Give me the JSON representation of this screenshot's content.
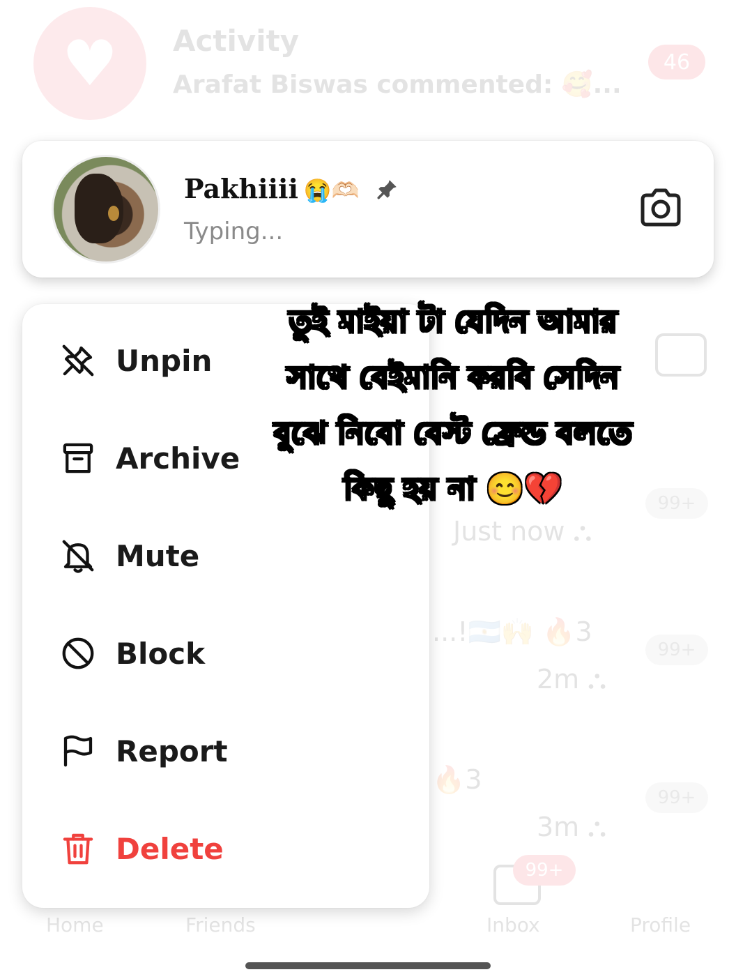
{
  "background": {
    "activity_title": "Activity",
    "activity_subtitle": "Arafat Biswas commented: 🥰...",
    "activity_badge": "46",
    "rows": [
      {
        "text": "Just now ⛬",
        "badge": "99+"
      },
      {
        "text": "...!🇦🇷🙌 🔥3",
        "badge": "99+"
      },
      {
        "text": "2m ⛬",
        "badge": ""
      },
      {
        "text": "🔥3",
        "badge": "99+"
      },
      {
        "text": "3m ⛬",
        "badge": ""
      }
    ],
    "nav": {
      "home": "Home",
      "friends": "Friends",
      "inbox": "Inbox",
      "inbox_badge": "99+",
      "profile": "Profile"
    }
  },
  "chat": {
    "name": "Pakhiiii",
    "name_emojis": "😭🫶🏻",
    "status": "Typing...",
    "pinned": true
  },
  "menu": {
    "items": [
      {
        "label": "Unpin",
        "icon": "unpin-icon"
      },
      {
        "label": "Archive",
        "icon": "archive-icon"
      },
      {
        "label": "Mute",
        "icon": "mute-bell-icon"
      },
      {
        "label": "Block",
        "icon": "block-icon"
      },
      {
        "label": "Report",
        "icon": "flag-icon"
      },
      {
        "label": "Delete",
        "icon": "trash-icon",
        "color": "#f0413d"
      }
    ]
  },
  "caption": {
    "lines": [
      "তুই মাইয়া টা যেদিন আমার",
      "সাথে বেইমানি করবি সেদিন",
      "বুঝে নিবো বেস্ট ফ্রেন্ড বলতে",
      "কিছু হয় না 😊💔"
    ]
  },
  "colors": {
    "danger": "#f0413d",
    "accent": "#f2384a",
    "muted_text": "#8a8a8a"
  }
}
